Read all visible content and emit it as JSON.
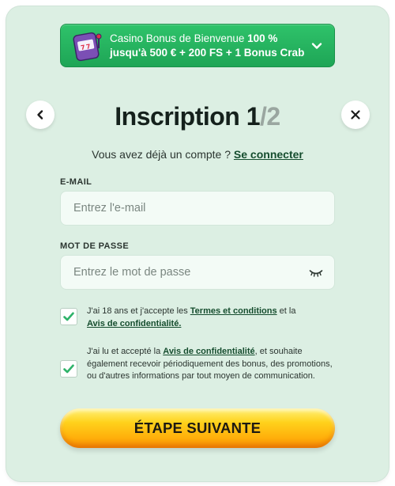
{
  "bonus": {
    "line1_prefix": "Casino Bonus de Bienvenue ",
    "line1_bold": "100 %",
    "line2": "jusqu'à 500 € + 200 FS + 1 Bonus Crab",
    "icon": "slot-machine-icon",
    "chevron_icon": "chevron-down-icon"
  },
  "header": {
    "title": "Inscription",
    "step_current": "1",
    "step_separator": "/",
    "step_total": "2",
    "back_icon": "chevron-left-icon",
    "close_icon": "close-icon"
  },
  "login": {
    "prompt": "Vous avez déjà un compte ? ",
    "link": "Se connecter"
  },
  "email": {
    "label": "E-MAIL",
    "placeholder": "Entrez l'e-mail",
    "value": ""
  },
  "password": {
    "label": "MOT DE PASSE",
    "placeholder": "Entrez le mot de passe",
    "value": "",
    "toggle_icon": "eye-closed-icon"
  },
  "consent_terms": {
    "checked": true,
    "text1": "J'ai 18 ans et j'accepte les ",
    "link1": "Termes et conditions",
    "text2": " et la ",
    "link2": "Avis de confidentialité."
  },
  "consent_marketing": {
    "checked": true,
    "text1": "J'ai lu et accepté la ",
    "link1": "Avis de confidentialité",
    "text2": ", et souhaite également recevoir périodiquement des bonus, des promotions, ou d'autres informations par tout moyen de communication."
  },
  "cta": {
    "label": "ÉTAPE SUIVANTE"
  },
  "colors": {
    "modal_bg": "#dcefe3",
    "bonus_green": "#24b35f",
    "link_dark_green": "#154d2e",
    "cta_yellow": "#ffd21c",
    "cta_orange": "#f58a06",
    "check_green": "#2fb36a"
  }
}
